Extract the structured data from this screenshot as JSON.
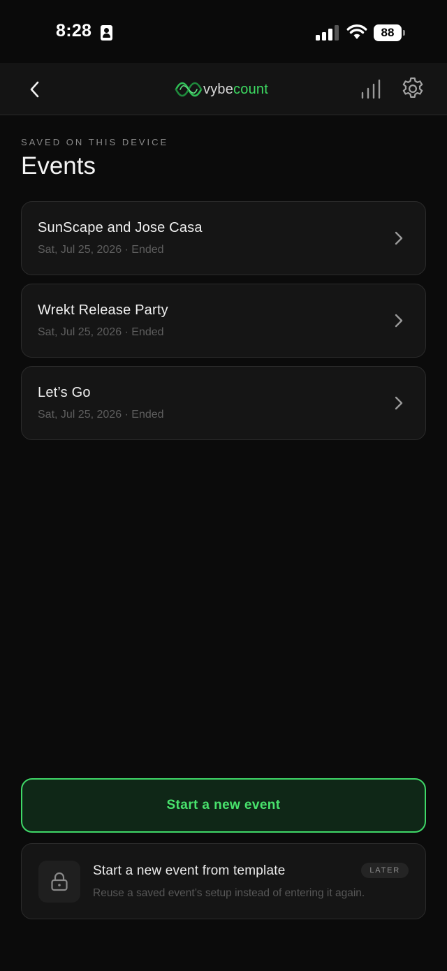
{
  "status_bar": {
    "time": "8:28",
    "battery": "88"
  },
  "nav": {
    "logo_prefix": "vybe",
    "logo_suffix": "count"
  },
  "section": {
    "eyebrow": "SAVED ON THIS DEVICE",
    "title": "Events"
  },
  "events": [
    {
      "name": "SunScape and Jose Casa",
      "meta": "Sat, Jul 25, 2026 · Ended"
    },
    {
      "name": "Wrekt Release Party",
      "meta": "Sat, Jul 25, 2026 · Ended"
    },
    {
      "name": "Let’s Go",
      "meta": "Sat, Jul 25, 2026 · Ended"
    }
  ],
  "actions": {
    "primary_label": "Start a new event",
    "template_title": "Start a new event from template",
    "template_desc": "Reuse a saved event’s setup instead of entering it again.",
    "template_badge": "LATER"
  },
  "colors": {
    "background": "#0b0b0b",
    "accent_green": "#3fd868",
    "card": "#151515"
  }
}
